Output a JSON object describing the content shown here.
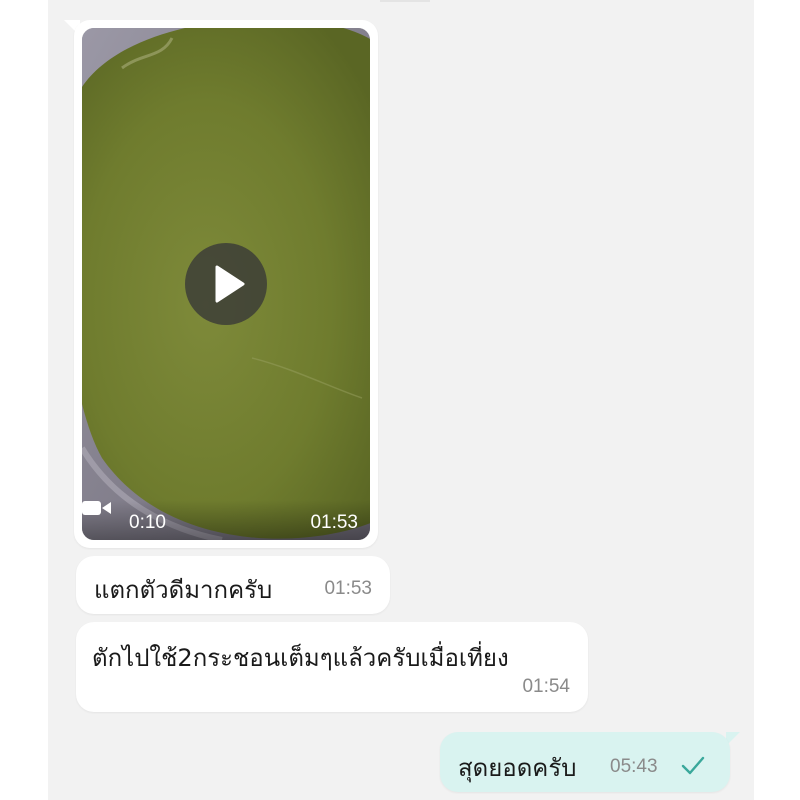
{
  "colors": {
    "chat_background": "#f2f2f2",
    "incoming_bubble": "#ffffff",
    "outgoing_bubble": "#d9f3f0",
    "read_check": "#3aa89b"
  },
  "video_message": {
    "duration": "0:10",
    "time": "01:53",
    "icons": {
      "camera": "video-camera-icon",
      "play": "play-icon"
    }
  },
  "messages": [
    {
      "direction": "incoming",
      "text": "แตกตัวดีมากครับ",
      "time": "01:53"
    },
    {
      "direction": "incoming",
      "text": "ตักไปใช้2กระชอนเต็มๆแล้วครับเมื่อเที่ยง",
      "time": "01:54"
    },
    {
      "direction": "outgoing",
      "text": "สุดยอดครับ",
      "time": "05:43",
      "status_icon": "check-icon"
    }
  ]
}
